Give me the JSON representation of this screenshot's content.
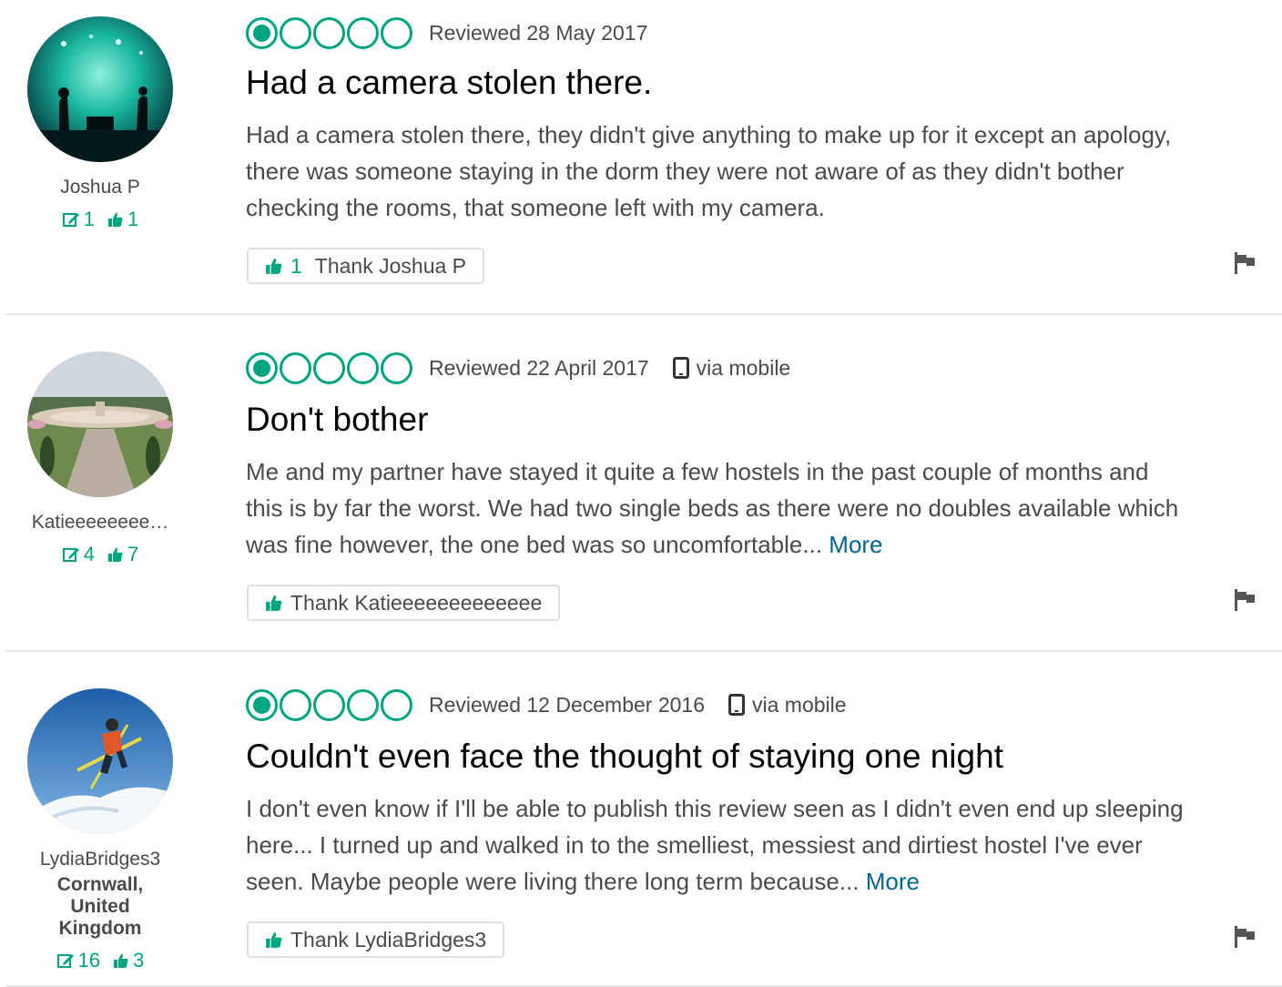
{
  "reviews": [
    {
      "username": "Joshua P",
      "location": "",
      "contributions": "1",
      "helpful_votes": "1",
      "rating": 1,
      "review_date": "Reviewed 28 May 2017",
      "via_mobile": "",
      "title": "Had a camera stolen there.",
      "body": "Had a camera stolen there, they didn't give anything to make up for it except an apology, there was someone staying in the dorm they were not aware of as they didn't bother checking the rooms, that someone left with my camera.",
      "more": "",
      "thank_count": "1",
      "thank_label": "Thank Joshua P",
      "avatar_icon": "concert-photo"
    },
    {
      "username": "Katieeeeeeee…",
      "location": "",
      "contributions": "4",
      "helpful_votes": "7",
      "rating": 1,
      "review_date": "Reviewed 22 April 2017",
      "via_mobile": "via mobile",
      "title": "Don't bother",
      "body": "Me and my partner have stayed it quite a few hostels in the past couple of months and this is by far the worst. We had two single beds as there were no doubles available which was fine however, the one bed was so uncomfortable...",
      "more": "More",
      "thank_count": "",
      "thank_label": "Thank Katieeeeeeeeeeeee",
      "avatar_icon": "garden-photo"
    },
    {
      "username": "LydiaBridges3",
      "location": "Cornwall, United Kingdom",
      "contributions": "16",
      "helpful_votes": "3",
      "rating": 1,
      "review_date": "Reviewed 12 December 2016",
      "via_mobile": "via mobile",
      "title": "Couldn't even face the thought of staying one night",
      "body": "I don't even know if I'll be able to publish this review seen as I didn't even end up sleeping here... I turned up and walked in to the smelliest, messiest and dirtiest hostel I've ever seen. Maybe people were living there long term because...",
      "more": "More",
      "thank_count": "",
      "thank_label": "Thank LydiaBridges3",
      "avatar_icon": "skier-photo"
    }
  ],
  "colors": {
    "accent": "#00a680",
    "link": "#006699",
    "text": "#4a4a4a",
    "divider": "#e5e5e5"
  },
  "icons": {
    "review_count": "edit-icon",
    "helpful": "thumbs-up-icon",
    "mobile": "mobile-phone-icon",
    "report": "flag-icon"
  }
}
